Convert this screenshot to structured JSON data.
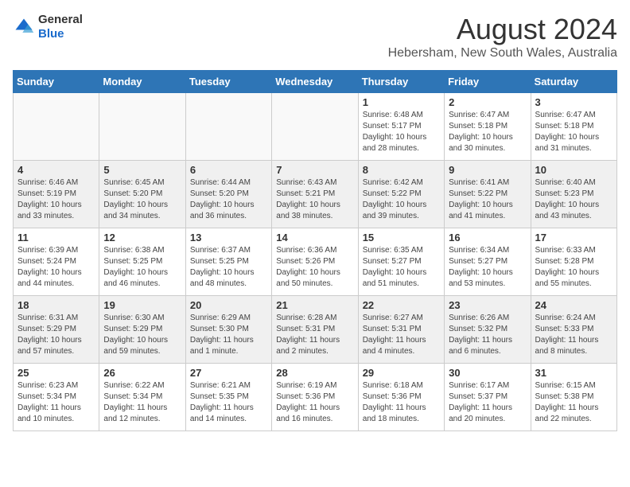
{
  "header": {
    "logo": {
      "general": "General",
      "blue": "Blue"
    },
    "month": "August 2024",
    "location": "Hebersham, New South Wales, Australia"
  },
  "weekdays": [
    "Sunday",
    "Monday",
    "Tuesday",
    "Wednesday",
    "Thursday",
    "Friday",
    "Saturday"
  ],
  "weeks": [
    [
      {
        "day": "",
        "empty": true
      },
      {
        "day": "",
        "empty": true
      },
      {
        "day": "",
        "empty": true
      },
      {
        "day": "",
        "empty": true
      },
      {
        "day": "1",
        "sunrise": "6:48 AM",
        "sunset": "5:17 PM",
        "daylight": "10 hours and 28 minutes."
      },
      {
        "day": "2",
        "sunrise": "6:47 AM",
        "sunset": "5:18 PM",
        "daylight": "10 hours and 30 minutes."
      },
      {
        "day": "3",
        "sunrise": "6:47 AM",
        "sunset": "5:18 PM",
        "daylight": "10 hours and 31 minutes."
      }
    ],
    [
      {
        "day": "4",
        "sunrise": "6:46 AM",
        "sunset": "5:19 PM",
        "daylight": "10 hours and 33 minutes."
      },
      {
        "day": "5",
        "sunrise": "6:45 AM",
        "sunset": "5:20 PM",
        "daylight": "10 hours and 34 minutes."
      },
      {
        "day": "6",
        "sunrise": "6:44 AM",
        "sunset": "5:20 PM",
        "daylight": "10 hours and 36 minutes."
      },
      {
        "day": "7",
        "sunrise": "6:43 AM",
        "sunset": "5:21 PM",
        "daylight": "10 hours and 38 minutes."
      },
      {
        "day": "8",
        "sunrise": "6:42 AM",
        "sunset": "5:22 PM",
        "daylight": "10 hours and 39 minutes."
      },
      {
        "day": "9",
        "sunrise": "6:41 AM",
        "sunset": "5:22 PM",
        "daylight": "10 hours and 41 minutes."
      },
      {
        "day": "10",
        "sunrise": "6:40 AM",
        "sunset": "5:23 PM",
        "daylight": "10 hours and 43 minutes."
      }
    ],
    [
      {
        "day": "11",
        "sunrise": "6:39 AM",
        "sunset": "5:24 PM",
        "daylight": "10 hours and 44 minutes."
      },
      {
        "day": "12",
        "sunrise": "6:38 AM",
        "sunset": "5:25 PM",
        "daylight": "10 hours and 46 minutes."
      },
      {
        "day": "13",
        "sunrise": "6:37 AM",
        "sunset": "5:25 PM",
        "daylight": "10 hours and 48 minutes."
      },
      {
        "day": "14",
        "sunrise": "6:36 AM",
        "sunset": "5:26 PM",
        "daylight": "10 hours and 50 minutes."
      },
      {
        "day": "15",
        "sunrise": "6:35 AM",
        "sunset": "5:27 PM",
        "daylight": "10 hours and 51 minutes."
      },
      {
        "day": "16",
        "sunrise": "6:34 AM",
        "sunset": "5:27 PM",
        "daylight": "10 hours and 53 minutes."
      },
      {
        "day": "17",
        "sunrise": "6:33 AM",
        "sunset": "5:28 PM",
        "daylight": "10 hours and 55 minutes."
      }
    ],
    [
      {
        "day": "18",
        "sunrise": "6:31 AM",
        "sunset": "5:29 PM",
        "daylight": "10 hours and 57 minutes."
      },
      {
        "day": "19",
        "sunrise": "6:30 AM",
        "sunset": "5:29 PM",
        "daylight": "10 hours and 59 minutes."
      },
      {
        "day": "20",
        "sunrise": "6:29 AM",
        "sunset": "5:30 PM",
        "daylight": "11 hours and 1 minute."
      },
      {
        "day": "21",
        "sunrise": "6:28 AM",
        "sunset": "5:31 PM",
        "daylight": "11 hours and 2 minutes."
      },
      {
        "day": "22",
        "sunrise": "6:27 AM",
        "sunset": "5:31 PM",
        "daylight": "11 hours and 4 minutes."
      },
      {
        "day": "23",
        "sunrise": "6:26 AM",
        "sunset": "5:32 PM",
        "daylight": "11 hours and 6 minutes."
      },
      {
        "day": "24",
        "sunrise": "6:24 AM",
        "sunset": "5:33 PM",
        "daylight": "11 hours and 8 minutes."
      }
    ],
    [
      {
        "day": "25",
        "sunrise": "6:23 AM",
        "sunset": "5:34 PM",
        "daylight": "11 hours and 10 minutes."
      },
      {
        "day": "26",
        "sunrise": "6:22 AM",
        "sunset": "5:34 PM",
        "daylight": "11 hours and 12 minutes."
      },
      {
        "day": "27",
        "sunrise": "6:21 AM",
        "sunset": "5:35 PM",
        "daylight": "11 hours and 14 minutes."
      },
      {
        "day": "28",
        "sunrise": "6:19 AM",
        "sunset": "5:36 PM",
        "daylight": "11 hours and 16 minutes."
      },
      {
        "day": "29",
        "sunrise": "6:18 AM",
        "sunset": "5:36 PM",
        "daylight": "11 hours and 18 minutes."
      },
      {
        "day": "30",
        "sunrise": "6:17 AM",
        "sunset": "5:37 PM",
        "daylight": "11 hours and 20 minutes."
      },
      {
        "day": "31",
        "sunrise": "6:15 AM",
        "sunset": "5:38 PM",
        "daylight": "11 hours and 22 minutes."
      }
    ]
  ],
  "labels": {
    "sunrise_prefix": "Sunrise: ",
    "sunset_prefix": "Sunset: ",
    "daylight_prefix": "Daylight: "
  }
}
